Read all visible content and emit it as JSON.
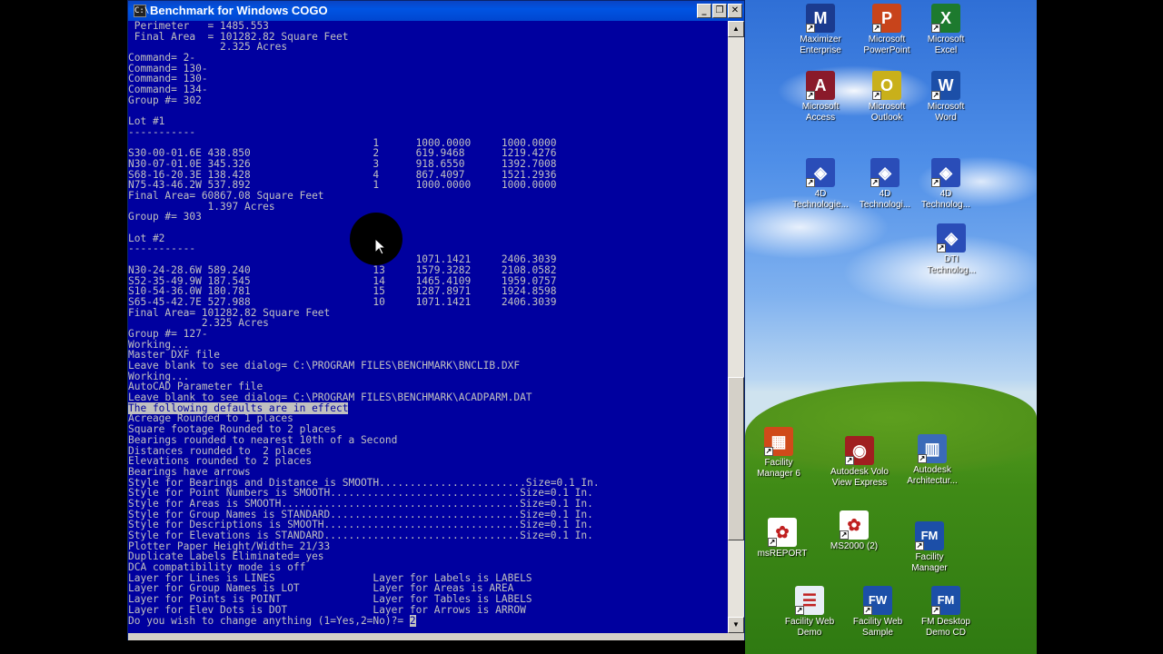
{
  "window": {
    "title": "Benchmark for Windows COGO",
    "minimize": "_",
    "maximize": "❐",
    "close": "✕"
  },
  "console_lines": [
    {
      "text": " Perimeter   = 1485.553"
    },
    {
      "text": " Final Area  = 101282.82 Square Feet"
    },
    {
      "text": "               2.325 Acres"
    },
    {
      "text": "Command= 2-"
    },
    {
      "text": "Command= 130-"
    },
    {
      "text": "Command= 130-"
    },
    {
      "text": "Command= 134-"
    },
    {
      "text": "Group #= 302"
    },
    {
      "text": ""
    },
    {
      "text": "Lot #1"
    },
    {
      "text": "-----------"
    },
    {
      "text": "                                        1      1000.0000     1000.0000"
    },
    {
      "text": "S30-00-01.6E 438.850                    2      619.9468      1219.4276"
    },
    {
      "text": "N30-07-01.0E 345.326                    3      918.6550      1392.7008"
    },
    {
      "text": "S68-16-20.3E 138.428                    4      867.4097      1521.2936"
    },
    {
      "text": "N75-43-46.2W 537.892                    1      1000.0000     1000.0000"
    },
    {
      "text": "Final Area= 60867.08 Square Feet"
    },
    {
      "text": "             1.397 Acres"
    },
    {
      "text": "Group #= 303"
    },
    {
      "text": ""
    },
    {
      "text": "Lot #2"
    },
    {
      "text": "-----------"
    },
    {
      "text": "                                        10     1071.1421     2406.3039"
    },
    {
      "text": "N30-24-28.6W 589.240                    13     1579.3282     2108.0582"
    },
    {
      "text": "S52-35-49.9W 187.545                    14     1465.4109     1959.0757"
    },
    {
      "text": "S10-54-36.0W 180.781                    15     1287.8971     1924.8598"
    },
    {
      "text": "S65-45-42.7E 527.988                    10     1071.1421     2406.3039"
    },
    {
      "text": "Final Area= 101282.82 Square Feet"
    },
    {
      "text": "            2.325 Acres"
    },
    {
      "text": "Group #= 127-"
    },
    {
      "text": "Working..."
    },
    {
      "text": "Master DXF file"
    },
    {
      "text": "Leave blank to see dialog= C:\\PROGRAM FILES\\BENCHMARK\\BNCLIB.DXF"
    },
    {
      "text": "Working..."
    },
    {
      "text": "AutoCAD Parameter file"
    },
    {
      "text": "Leave blank to see dialog= C:\\PROGRAM FILES\\BENCHMARK\\ACADPARM.DAT"
    },
    {
      "text": "The following defaults are in effect",
      "highlight": true
    },
    {
      "text": "Acreage Rounded to 1 places"
    },
    {
      "text": "Square footage Rounded to 2 places"
    },
    {
      "text": "Bearings rounded to nearest 10th of a Second"
    },
    {
      "text": "Distances rounded to  2 places"
    },
    {
      "text": "Elevations rounded to 2 places"
    },
    {
      "text": "Bearings have arrows"
    },
    {
      "text": "Style for Bearings and Distance is SMOOTH........................Size=0.1 In."
    },
    {
      "text": "Style for Point Numbers is SMOOTH...............................Size=0.1 In."
    },
    {
      "text": "Style for Areas is SMOOTH.......................................Size=0.1 In."
    },
    {
      "text": "Style for Group Names is STANDARD...............................Size=0.1 In."
    },
    {
      "text": "Style for Descriptions is SMOOTH................................Size=0.1 In."
    },
    {
      "text": "Style for Elevations is STANDARD................................Size=0.1 In."
    },
    {
      "text": "Plotter Paper Height/Width= 21/33"
    },
    {
      "text": "Duplicate Labels Eliminated= yes"
    },
    {
      "text": "DCA compatibility mode is off"
    },
    {
      "text": "Layer for Lines is LINES                Layer for Labels is LABELS"
    },
    {
      "text": "Layer for Group Names is LOT            Layer for Areas is AREA"
    },
    {
      "text": "Layer for Points is POINT               Layer for Tables is LABELS"
    },
    {
      "text": "Layer for Elev Dots is DOT              Layer for Arrows is ARROW"
    },
    {
      "text": "Do you wish to change anything (1=Yes,2=No)?= ",
      "input": "2"
    }
  ],
  "scrollbar": {
    "up": "▲",
    "down": "▼"
  },
  "desktop_icons": [
    {
      "id": "maximizer",
      "line1": "Maximizer",
      "line2": "Enterprise",
      "color": "#1b3b8f",
      "glyph": "M"
    },
    {
      "id": "powerpoint",
      "line1": "Microsoft",
      "line2": "PowerPoint",
      "color": "#c8441b",
      "glyph": "P"
    },
    {
      "id": "excel",
      "line1": "Microsoft",
      "line2": "Excel",
      "color": "#1d7a2e",
      "glyph": "X"
    },
    {
      "id": "access",
      "line1": "Microsoft",
      "line2": "Access",
      "color": "#8a1a2a",
      "glyph": "A"
    },
    {
      "id": "outlook",
      "line1": "Microsoft",
      "line2": "Outlook",
      "color": "#c9b01a",
      "glyph": "O"
    },
    {
      "id": "word",
      "line1": "Microsoft",
      "line2": "Word",
      "color": "#1c4fa8",
      "glyph": "W"
    },
    {
      "id": "4d-1",
      "line1": "4D",
      "line2": "Technologie...",
      "color": "#2a4db8",
      "glyph": "◈"
    },
    {
      "id": "4d-2",
      "line1": "4D",
      "line2": "Technologi...",
      "color": "#2a4db8",
      "glyph": "◈"
    },
    {
      "id": "4d-3",
      "line1": "4D",
      "line2": "Technolog...",
      "color": "#2a4db8",
      "glyph": "◈"
    },
    {
      "id": "dti",
      "line1": "DTI",
      "line2": "Technolog...",
      "color": "#2a4db8",
      "glyph": "◈"
    },
    {
      "id": "facility-manager-6",
      "line1": "Facility",
      "line2": "Manager 6",
      "color": "#d04a1a",
      "glyph": "▦"
    },
    {
      "id": "volo-view",
      "line1": "Autodesk Volo",
      "line2": "View Express",
      "color": "#a02020",
      "glyph": "◉"
    },
    {
      "id": "architectural",
      "line1": "Autodesk",
      "line2": "Architectur...",
      "color": "#3a6ab8",
      "glyph": "▥"
    },
    {
      "id": "msreport",
      "line1": "msREPORT",
      "line2": "",
      "color": "#ffffff",
      "glyph": "✿"
    },
    {
      "id": "ms2000",
      "line1": "MS2000 (2)",
      "line2": "",
      "color": "#ffffff",
      "glyph": "✿"
    },
    {
      "id": "facility-manager",
      "line1": "Facility",
      "line2": "Manager",
      "color": "#1c4fa8",
      "glyph": "FM"
    },
    {
      "id": "facility-web-demo",
      "line1": "Facility Web",
      "line2": "Demo",
      "color": "#e8eef6",
      "glyph": "☰"
    },
    {
      "id": "facility-web-sample",
      "line1": "Facility Web",
      "line2": "Sample",
      "color": "#1c4fa8",
      "glyph": "FW"
    },
    {
      "id": "fm-desktop-demo",
      "line1": "FM Desktop",
      "line2": "Demo CD",
      "color": "#1c4fa8",
      "glyph": "FM"
    }
  ],
  "colors": {
    "console_bg": "#00009f",
    "console_fg": "#c0c0c0",
    "title_bar": "#0054e3"
  }
}
